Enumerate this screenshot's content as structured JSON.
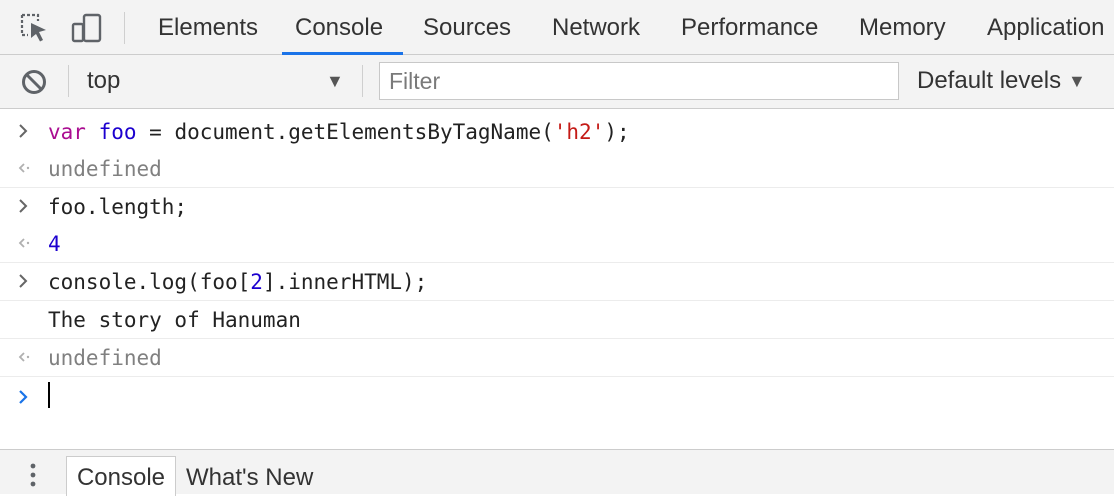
{
  "tabs": {
    "items": [
      {
        "label": "Elements"
      },
      {
        "label": "Console"
      },
      {
        "label": "Sources"
      },
      {
        "label": "Network"
      },
      {
        "label": "Performance"
      },
      {
        "label": "Memory"
      },
      {
        "label": "Application"
      }
    ],
    "active": "Console"
  },
  "toolbar": {
    "context": "top",
    "filter_placeholder": "Filter",
    "levels": "Default levels"
  },
  "console": {
    "rows": [
      {
        "type": "input",
        "tokens": [
          {
            "text": "var",
            "style": "kw"
          },
          {
            "text": " "
          },
          {
            "text": "foo",
            "style": "var"
          },
          {
            "text": " = document.getElementsByTagName("
          },
          {
            "text": "'h2'",
            "style": "str"
          },
          {
            "text": ");"
          }
        ]
      },
      {
        "type": "result",
        "text": "undefined"
      },
      {
        "type": "input",
        "text": "foo.length;"
      },
      {
        "type": "result",
        "text": "4"
      },
      {
        "type": "input",
        "tokens": [
          {
            "text": "console.log(foo["
          },
          {
            "text": "2",
            "style": "num"
          },
          {
            "text": "].innerHTML);"
          }
        ]
      },
      {
        "type": "log",
        "text": "The story of Hanuman"
      },
      {
        "type": "result",
        "text": "undefined"
      }
    ]
  },
  "drawer": {
    "active_tab": "Console",
    "other_tab": "What's New"
  },
  "colors": {
    "accent": "#1a73e8",
    "keyword": "#aa0d91",
    "variable": "#1c00cf",
    "string": "#c41a16",
    "number": "#1c00cf",
    "muted": "#808080"
  }
}
